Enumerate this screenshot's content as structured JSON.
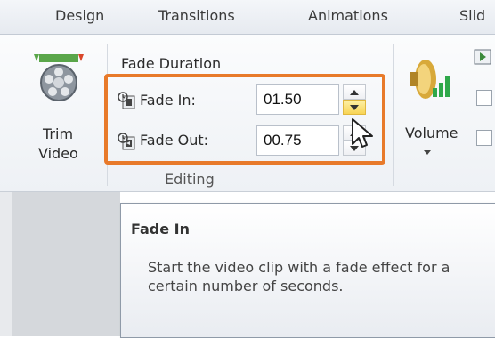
{
  "tabs": [
    {
      "label": "Design"
    },
    {
      "label": "Transitions"
    },
    {
      "label": "Animations"
    },
    {
      "label": "Slid"
    }
  ],
  "trim_video": {
    "line1": "Trim",
    "line2": "Video",
    "icon": "film-reel-icon"
  },
  "editing": {
    "header": "Fade Duration",
    "fade_in": {
      "label": "Fade In:",
      "value": "01.50",
      "icon": "fade-in-icon"
    },
    "fade_out": {
      "label": "Fade Out:",
      "value": "00.75",
      "icon": "fade-out-icon"
    },
    "group_label": "Editing"
  },
  "volume": {
    "label": "Volume",
    "icon": "speaker-icon"
  },
  "tooltip": {
    "title": "Fade In",
    "body": "Start the video clip with a fade effect for a certain number of seconds."
  },
  "colors": {
    "highlight": "#e87a2a",
    "spin_hover": "#f8d455"
  }
}
